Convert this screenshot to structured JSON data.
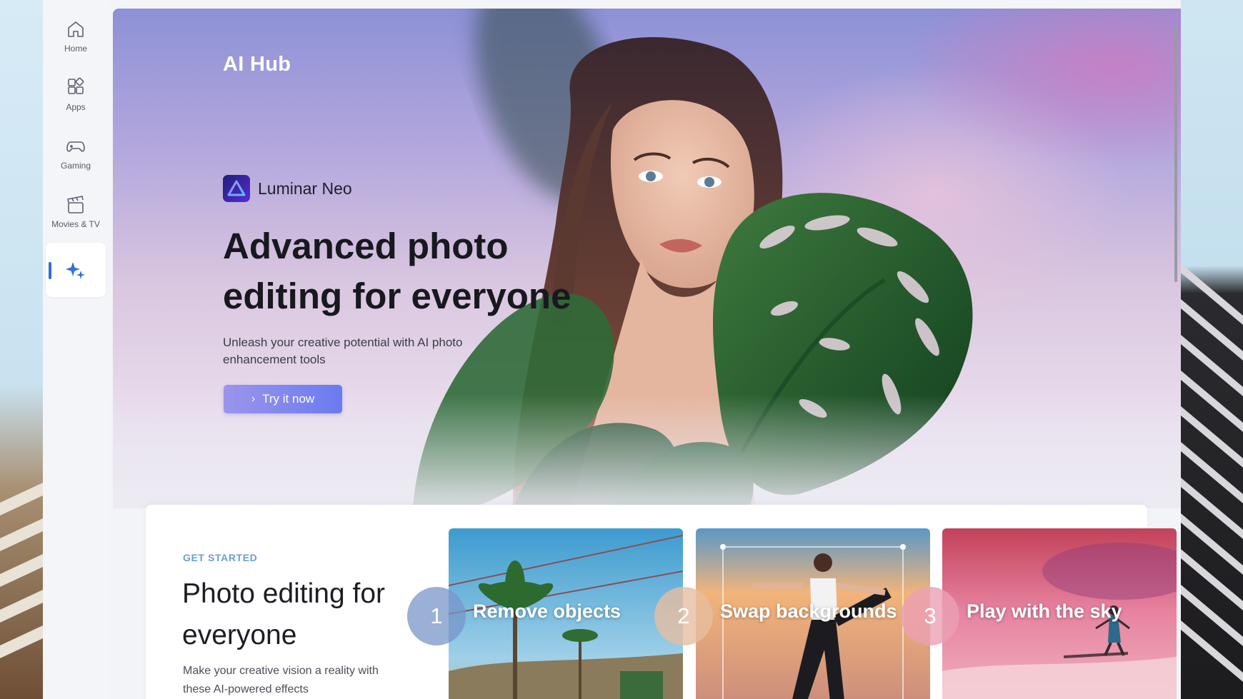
{
  "sidebar": {
    "items": [
      {
        "label": "Home",
        "icon": "home-icon"
      },
      {
        "label": "Apps",
        "icon": "apps-icon"
      },
      {
        "label": "Gaming",
        "icon": "gamepad-icon"
      },
      {
        "label": "Movies & TV",
        "icon": "clapperboard-icon"
      },
      {
        "label": "",
        "icon": "sparkle-icon",
        "active": true
      }
    ],
    "accent_color": "#2e6fd8"
  },
  "hero": {
    "title": "AI Hub",
    "brand": "Luminar Neo",
    "headline": "Advanced photo editing for everyone",
    "subtext": "Unleash your creative potential with AI photo enhancement tools",
    "cta_label": "Try it now"
  },
  "get_started": {
    "label": "GET STARTED",
    "title": "Photo editing for everyone",
    "description": "Make your creative vision a reality with these AI-powered effects",
    "cards": [
      {
        "number": "1",
        "title": "Remove objects"
      },
      {
        "number": "2",
        "title": "Swap backgrounds"
      },
      {
        "number": "3",
        "title": "Play with the sky"
      }
    ]
  }
}
